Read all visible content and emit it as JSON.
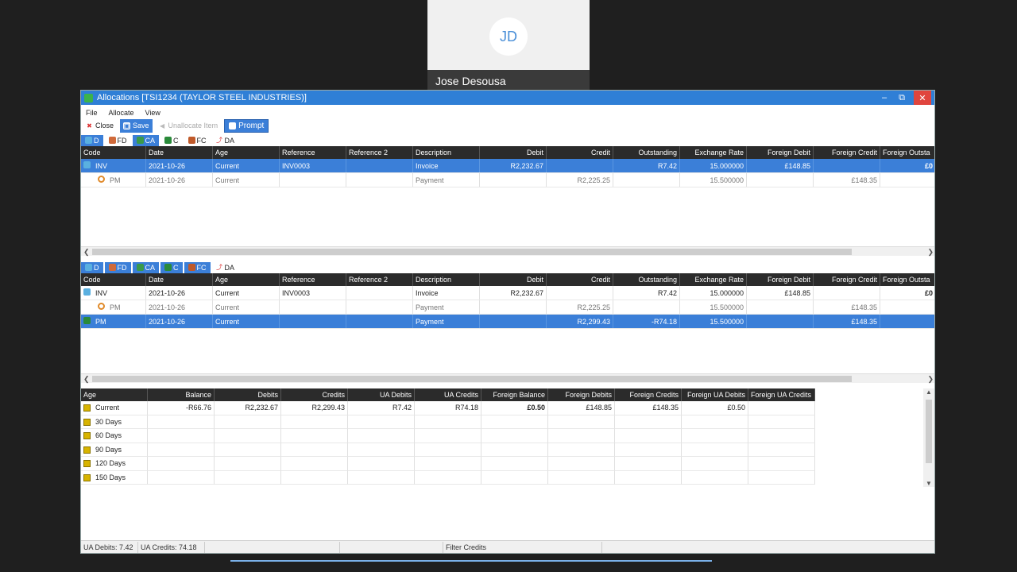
{
  "participant": {
    "initials": "JD",
    "name": "Jose Desousa"
  },
  "window": {
    "title": "Allocations [TSI1234 (TAYLOR STEEL INDUSTRIES)]"
  },
  "menu": [
    "File",
    "Allocate",
    "View"
  ],
  "toolbar": {
    "close": "Close",
    "save": "Save",
    "unallocate": "Unallocate Item",
    "prompt": "Prompt"
  },
  "filters": [
    "D",
    "FD",
    "CA",
    "C",
    "FC",
    "DA"
  ],
  "columns": [
    "Code",
    "Date",
    "Age",
    "Reference",
    "Reference 2",
    "Description",
    "Debit",
    "Credit",
    "Outstanding",
    "Exchange Rate",
    "Foreign Debit",
    "Foreign Credit",
    "Foreign Outsta"
  ],
  "top_rows": [
    {
      "code": "INV",
      "date": "2021-10-26",
      "age": "Current",
      "ref": "INV0003",
      "ref2": "",
      "desc": "Invoice",
      "debit": "R2,232.67",
      "credit": "",
      "out": "R7.42",
      "ex": "15.000000",
      "fd": "£148.85",
      "fc": "",
      "fo": "£0"
    },
    {
      "code": "PM",
      "date": "2021-10-26",
      "age": "Current",
      "ref": "",
      "ref2": "",
      "desc": "Payment",
      "debit": "",
      "credit": "R2,225.25",
      "out": "",
      "ex": "15.500000",
      "fd": "",
      "fc": "£148.35",
      "fo": ""
    }
  ],
  "bottom_rows": [
    {
      "code": "INV",
      "date": "2021-10-26",
      "age": "Current",
      "ref": "INV0003",
      "ref2": "",
      "desc": "Invoice",
      "debit": "R2,232.67",
      "credit": "",
      "out": "R7.42",
      "ex": "15.000000",
      "fd": "£148.85",
      "fc": "",
      "fo": "£0"
    },
    {
      "code": "PM",
      "date": "2021-10-26",
      "age": "Current",
      "ref": "",
      "ref2": "",
      "desc": "Payment",
      "debit": "",
      "credit": "R2,225.25",
      "out": "",
      "ex": "15.500000",
      "fd": "",
      "fc": "£148.35",
      "fo": ""
    },
    {
      "code": "PM",
      "date": "2021-10-26",
      "age": "Current",
      "ref": "",
      "ref2": "",
      "desc": "Payment",
      "debit": "",
      "credit": "R2,299.43",
      "out": "-R74.18",
      "ex": "15.500000",
      "fd": "",
      "fc": "£148.35",
      "fo": ""
    }
  ],
  "aging_columns": [
    "Age",
    "Balance",
    "Debits",
    "Credits",
    "UA Debits",
    "UA Credits",
    "Foreign Balance",
    "Foreign Debits",
    "Foreign Credits",
    "Foreign UA Debits",
    "Foreign UA Credits"
  ],
  "aging_rows": [
    {
      "age": "Current",
      "balance": "-R66.76",
      "debits": "R2,232.67",
      "credits": "R2,299.43",
      "ua_debits": "R7.42",
      "ua_credits": "R74.18",
      "f_balance": "£0.50",
      "f_debits": "£148.85",
      "f_credits": "£148.35",
      "f_ua_debits": "£0.50",
      "f_ua_credits": ""
    },
    {
      "age": "30 Days"
    },
    {
      "age": "60 Days"
    },
    {
      "age": "90 Days"
    },
    {
      "age": "120 Days"
    },
    {
      "age": "150 Days"
    }
  ],
  "status": {
    "ua_debits": "UA Debits: 7.42",
    "ua_credits": "UA Credits: 74.18",
    "filter": "Filter Credits"
  }
}
